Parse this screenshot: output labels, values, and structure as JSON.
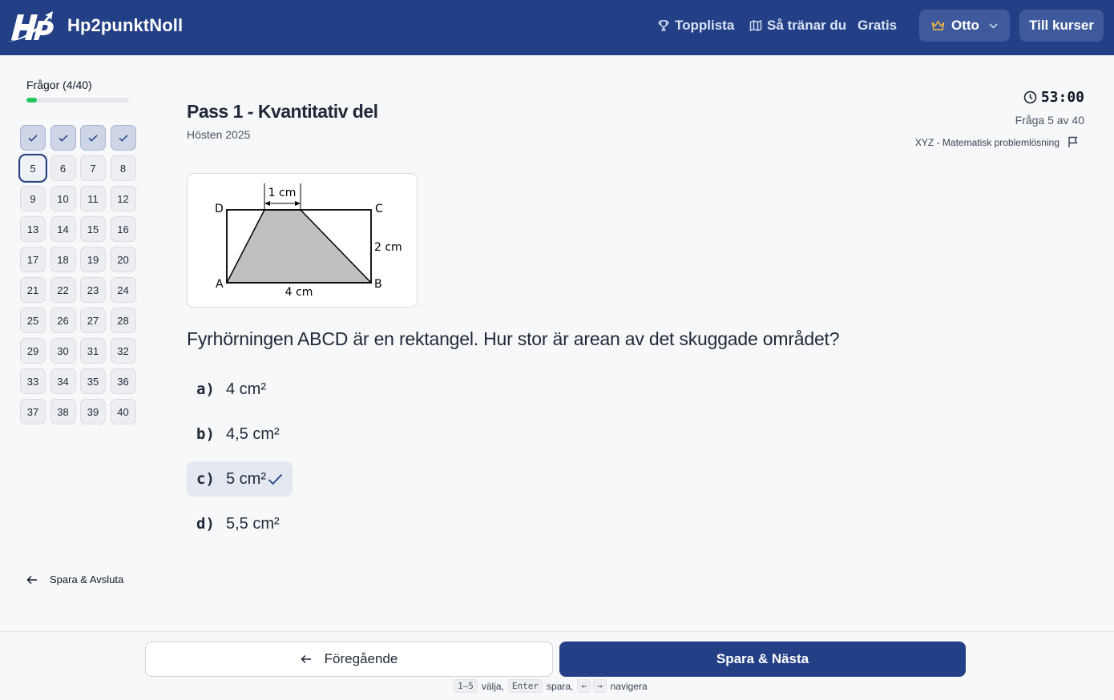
{
  "header": {
    "brand": "Hp2punktNoll",
    "nav": {
      "leaderboard": "Topplista",
      "how_to_train": "Så tränar du",
      "free": "Gratis"
    },
    "user": "Otto",
    "courses_button": "Till kurser"
  },
  "sidebar": {
    "questions_heading": "Frågor (4/40)",
    "progress": 0.1,
    "questions": [
      {
        "label": "",
        "state": "done"
      },
      {
        "label": "",
        "state": "done"
      },
      {
        "label": "",
        "state": "done"
      },
      {
        "label": "",
        "state": "done"
      },
      {
        "label": "5",
        "state": "current"
      },
      {
        "label": "6",
        "state": "open"
      },
      {
        "label": "7",
        "state": "open"
      },
      {
        "label": "8",
        "state": "open"
      },
      {
        "label": "9",
        "state": "open"
      },
      {
        "label": "10",
        "state": "open"
      },
      {
        "label": "11",
        "state": "open"
      },
      {
        "label": "12",
        "state": "open"
      },
      {
        "label": "13",
        "state": "open"
      },
      {
        "label": "14",
        "state": "open"
      },
      {
        "label": "15",
        "state": "open"
      },
      {
        "label": "16",
        "state": "open"
      },
      {
        "label": "17",
        "state": "open"
      },
      {
        "label": "18",
        "state": "open"
      },
      {
        "label": "19",
        "state": "open"
      },
      {
        "label": "20",
        "state": "open"
      },
      {
        "label": "21",
        "state": "open"
      },
      {
        "label": "22",
        "state": "open"
      },
      {
        "label": "23",
        "state": "open"
      },
      {
        "label": "24",
        "state": "open"
      },
      {
        "label": "25",
        "state": "open"
      },
      {
        "label": "26",
        "state": "open"
      },
      {
        "label": "27",
        "state": "open"
      },
      {
        "label": "28",
        "state": "open"
      },
      {
        "label": "29",
        "state": "open"
      },
      {
        "label": "30",
        "state": "open"
      },
      {
        "label": "31",
        "state": "open"
      },
      {
        "label": "32",
        "state": "open"
      },
      {
        "label": "33",
        "state": "open"
      },
      {
        "label": "34",
        "state": "open"
      },
      {
        "label": "35",
        "state": "open"
      },
      {
        "label": "36",
        "state": "open"
      },
      {
        "label": "37",
        "state": "open"
      },
      {
        "label": "38",
        "state": "open"
      },
      {
        "label": "39",
        "state": "open"
      },
      {
        "label": "40",
        "state": "open"
      }
    ],
    "save_exit": "Spara & Avsluta"
  },
  "exam": {
    "title": "Pass 1 - Kvantitativ del",
    "subtitle": "Hösten 2025",
    "timer": "53:00",
    "question_count": "Fråga 5 av 40",
    "category": "XYZ - Matematisk problemlösning"
  },
  "figure": {
    "labels": {
      "a": "A",
      "b": "B",
      "c": "C",
      "d": "D",
      "top": "1 cm",
      "right": "2 cm",
      "bottom": "4 cm"
    }
  },
  "question": {
    "text": "Fyrhörningen ABCD är en rektangel. Hur stor är arean av det skuggade området?",
    "answers": [
      {
        "letter": "a)",
        "text": "4 cm²",
        "selected": false
      },
      {
        "letter": "b)",
        "text": "4,5 cm²",
        "selected": false
      },
      {
        "letter": "c)",
        "text": "5 cm²",
        "selected": true
      },
      {
        "letter": "d)",
        "text": "5,5 cm²",
        "selected": false
      }
    ]
  },
  "footer": {
    "prev": "Föregående",
    "next": "Spara & Nästa",
    "hint": {
      "k1": "1–5",
      "t1": "välja,",
      "k2": "Enter",
      "t2": "spara,",
      "k3": "←",
      "k4": "→",
      "t3": "navigera"
    }
  },
  "colors": {
    "primary": "#233f86",
    "progress": "#22c55e",
    "crown": "#f5b93c"
  }
}
